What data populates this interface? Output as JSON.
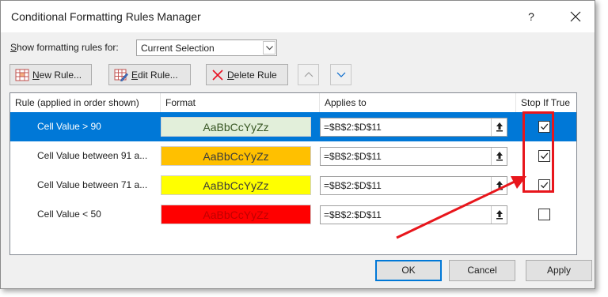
{
  "dialog": {
    "title": "Conditional Formatting Rules Manager",
    "help": "?",
    "show_label_prefix": "S",
    "show_label_rest": "how formatting rules for:",
    "scope_value": "Current Selection"
  },
  "toolbar": {
    "new_rule_u": "N",
    "new_rule_rest": "ew Rule...",
    "edit_rule_u": "E",
    "edit_rule_rest": "dit Rule...",
    "delete_rule_u": "D",
    "delete_rule_rest": "elete Rule"
  },
  "grid": {
    "headers": [
      "Rule (applied in order shown)",
      "Format",
      "Applies to",
      "Stop If True"
    ],
    "rows": [
      {
        "rule": "Cell Value > 90",
        "format_sample": "AaBbCcYyZz",
        "applies_to": "=$B$2:$D$11",
        "stop_if_true": true,
        "fill": "#e2efda",
        "font": "#375623",
        "selected": true
      },
      {
        "rule": "Cell Value between 91 a...",
        "format_sample": "AaBbCcYyZz",
        "applies_to": "=$B$2:$D$11",
        "stop_if_true": true,
        "fill": "#ffc000",
        "font": "#3a3a3a",
        "selected": false
      },
      {
        "rule": "Cell Value between 71 a...",
        "format_sample": "AaBbCcYyZz",
        "applies_to": "=$B$2:$D$11",
        "stop_if_true": true,
        "fill": "#ffff00",
        "font": "#3a3a3a",
        "selected": false
      },
      {
        "rule": "Cell Value < 50",
        "format_sample": "AaBbCcYyZz",
        "applies_to": "=$B$2:$D$11",
        "stop_if_true": false,
        "fill": "#ff0000",
        "font": "#c00000",
        "selected": false
      }
    ]
  },
  "buttons": {
    "ok": "OK",
    "cancel": "Cancel",
    "apply": "Apply"
  },
  "colors": {
    "selection": "#0078d7",
    "annotation": "#e8161c"
  }
}
